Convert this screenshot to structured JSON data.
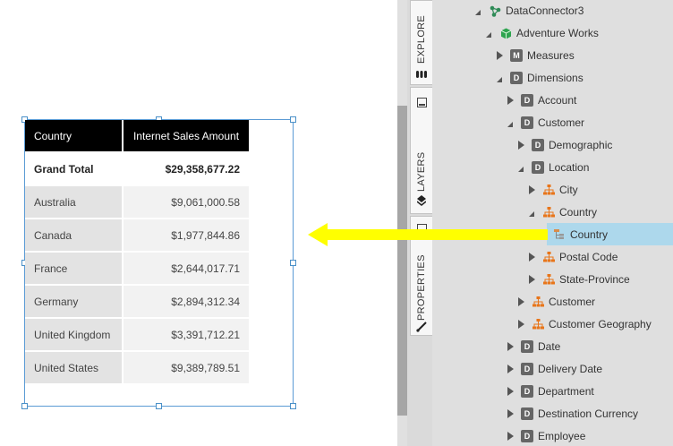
{
  "colors": {
    "header_bg": "#000000",
    "selected_node_bg": "#add8ec",
    "arrow": "#ffff00",
    "hierarchy_icon": "#e8751a",
    "cube_icon": "#2ea44f",
    "connector_icon": "#2e8b57",
    "selection_border": "#5b9bd5"
  },
  "table": {
    "headers": [
      "Country",
      "Internet Sales Amount"
    ],
    "grand_total": {
      "label": "Grand Total",
      "value": "$29,358,677.22"
    },
    "rows": [
      {
        "country": "Australia",
        "amount": "$9,061,000.58"
      },
      {
        "country": "Canada",
        "amount": "$1,977,844.86"
      },
      {
        "country": "France",
        "amount": "$2,644,017.71"
      },
      {
        "country": "Germany",
        "amount": "$2,894,312.34"
      },
      {
        "country": "United Kingdom",
        "amount": "$3,391,712.21"
      },
      {
        "country": "United States",
        "amount": "$9,389,789.51"
      }
    ]
  },
  "tabs": {
    "explore": {
      "label": "EXPLORE",
      "icon": "database-icon"
    },
    "layers": {
      "label": "LAYERS",
      "icon": "layers-icon"
    },
    "properties": {
      "label": "PROPERTIES",
      "icon": "brush-icon"
    }
  },
  "tree": {
    "nodes": [
      {
        "label": "DataConnector3",
        "icon": "connector-icon",
        "toggle": "expanded",
        "depth": 0
      },
      {
        "label": "Adventure Works",
        "icon": "cube-icon",
        "toggle": "expanded",
        "depth": 1
      },
      {
        "label": "Measures",
        "icon": "M",
        "toggle": "collapsed",
        "depth": 2
      },
      {
        "label": "Dimensions",
        "icon": "D",
        "toggle": "expanded",
        "depth": 2
      },
      {
        "label": "Account",
        "icon": "D",
        "toggle": "collapsed",
        "depth": 3
      },
      {
        "label": "Customer",
        "icon": "D",
        "toggle": "expanded",
        "depth": 3
      },
      {
        "label": "Demographic",
        "icon": "D",
        "toggle": "collapsed",
        "depth": 4
      },
      {
        "label": "Location",
        "icon": "D",
        "toggle": "expanded",
        "depth": 4
      },
      {
        "label": "City",
        "icon": "hierarchy-icon",
        "toggle": "collapsed",
        "depth": 5
      },
      {
        "label": "Country",
        "icon": "hierarchy-icon",
        "toggle": "expanded",
        "depth": 5
      },
      {
        "label": "Country",
        "icon": "level-icon",
        "toggle": "none",
        "depth": 6,
        "selected": true
      },
      {
        "label": "Postal Code",
        "icon": "hierarchy-icon",
        "toggle": "collapsed",
        "depth": 5
      },
      {
        "label": "State-Province",
        "icon": "hierarchy-icon",
        "toggle": "collapsed",
        "depth": 5
      },
      {
        "label": "Customer",
        "icon": "hierarchy-icon",
        "toggle": "collapsed",
        "depth": 4
      },
      {
        "label": "Customer Geography",
        "icon": "hierarchy-icon",
        "toggle": "collapsed",
        "depth": 4
      },
      {
        "label": "Date",
        "icon": "D",
        "toggle": "collapsed",
        "depth": 3
      },
      {
        "label": "Delivery Date",
        "icon": "D",
        "toggle": "collapsed",
        "depth": 3
      },
      {
        "label": "Department",
        "icon": "D",
        "toggle": "collapsed",
        "depth": 3
      },
      {
        "label": "Destination Currency",
        "icon": "D",
        "toggle": "collapsed",
        "depth": 3
      },
      {
        "label": "Employee",
        "icon": "D",
        "toggle": "collapsed",
        "depth": 3
      }
    ]
  }
}
